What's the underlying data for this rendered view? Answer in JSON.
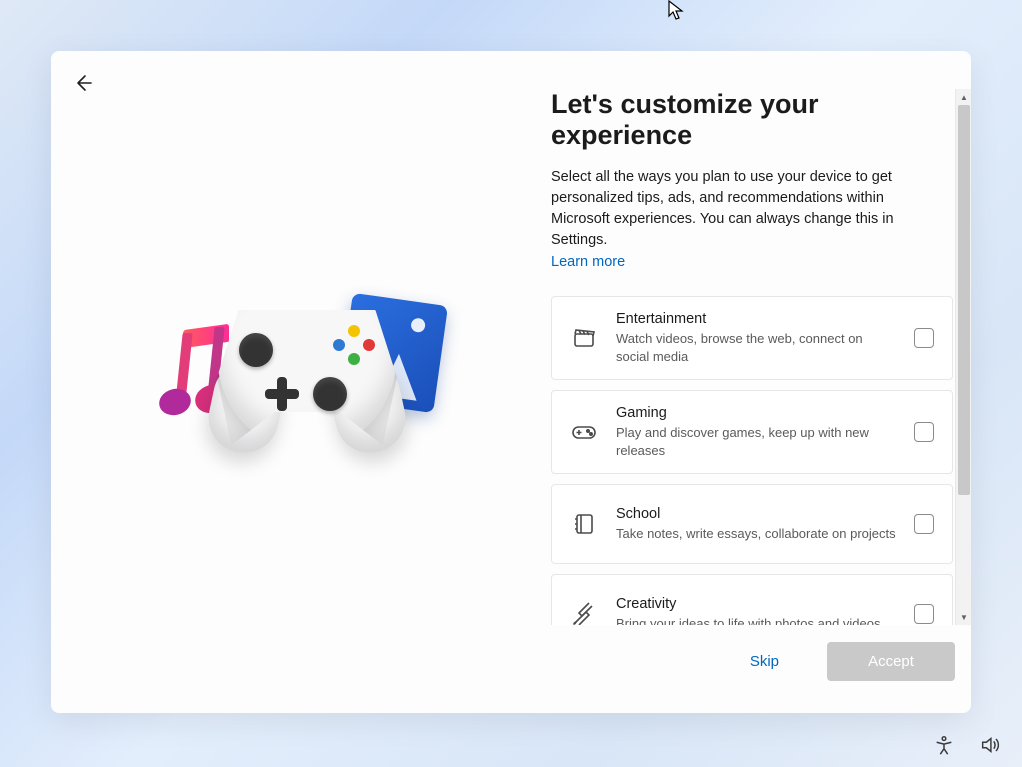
{
  "title": "Let's customize your experience",
  "subtitle": "Select all the ways you plan to use your device to get personalized tips, ads, and recommendations within Microsoft experiences. You can always change this in Settings.",
  "learn_more": "Learn more",
  "options": [
    {
      "icon": "clapperboard",
      "name": "Entertainment",
      "desc": "Watch videos, browse the web, connect on social media"
    },
    {
      "icon": "gamepad",
      "name": "Gaming",
      "desc": "Play and discover games, keep up with new releases"
    },
    {
      "icon": "notebook",
      "name": "School",
      "desc": "Take notes, write essays, collaborate on projects"
    },
    {
      "icon": "brush",
      "name": "Creativity",
      "desc": "Bring your ideas to life with photos and videos"
    }
  ],
  "buttons": {
    "skip": "Skip",
    "accept": "Accept"
  },
  "tray": {
    "accessibility": "Accessibility",
    "volume": "Volume"
  }
}
